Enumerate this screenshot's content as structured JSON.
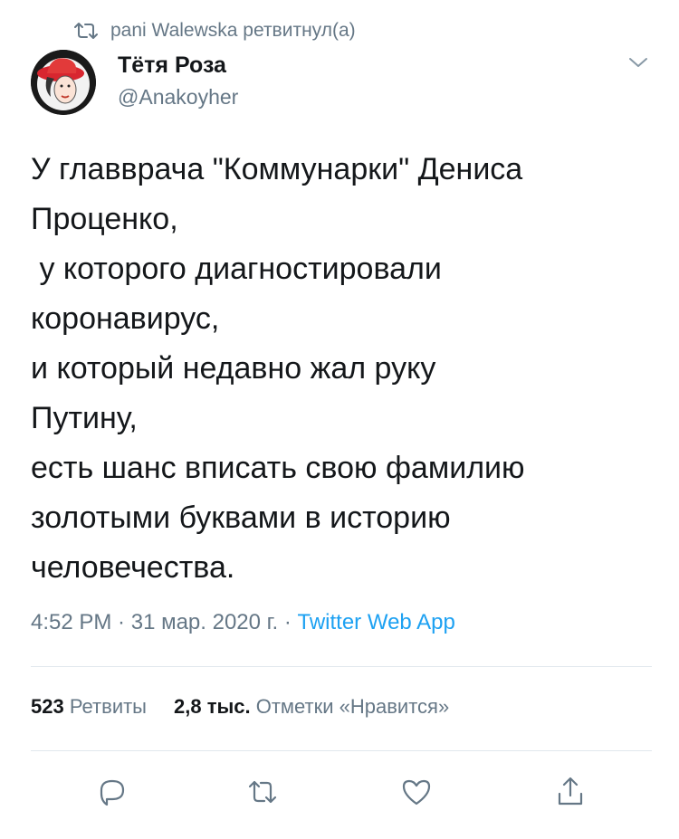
{
  "retweet_context": {
    "text": "pani Walewska ретвитнул(а)",
    "icon": "retweet-icon"
  },
  "author": {
    "name": "Тётя Роза",
    "handle": "@Anakoyher",
    "avatar": "avatar-red-hat-woman"
  },
  "tweet": {
    "lines": [
      "У главврача \"Коммунарки\" Дениса",
      "Проценко,",
      " у которого диагностировали",
      "коронавирус,",
      "и который недавно жал руку",
      "Путину,",
      "есть шанс вписать свою фамилию",
      "золотыми буквами в историю",
      "человечества."
    ]
  },
  "meta": {
    "time": "4:52 PM",
    "separator1": " · ",
    "date": "31 мар. 2020 г.",
    "separator2": " · ",
    "source": "Twitter Web App"
  },
  "stats": {
    "retweets_count": "523",
    "retweets_label": "Ретвиты",
    "likes_count": "2,8 тыс.",
    "likes_label": "Отметки «Нравится»"
  },
  "actions": [
    {
      "name": "reply",
      "icon": "reply-icon"
    },
    {
      "name": "retweet",
      "icon": "retweet-icon"
    },
    {
      "name": "like",
      "icon": "heart-icon"
    },
    {
      "name": "share",
      "icon": "share-icon"
    }
  ],
  "colors": {
    "text_primary": "#14171a",
    "text_secondary": "#657786",
    "link": "#1da1f2",
    "divider": "#e1e8ed"
  }
}
